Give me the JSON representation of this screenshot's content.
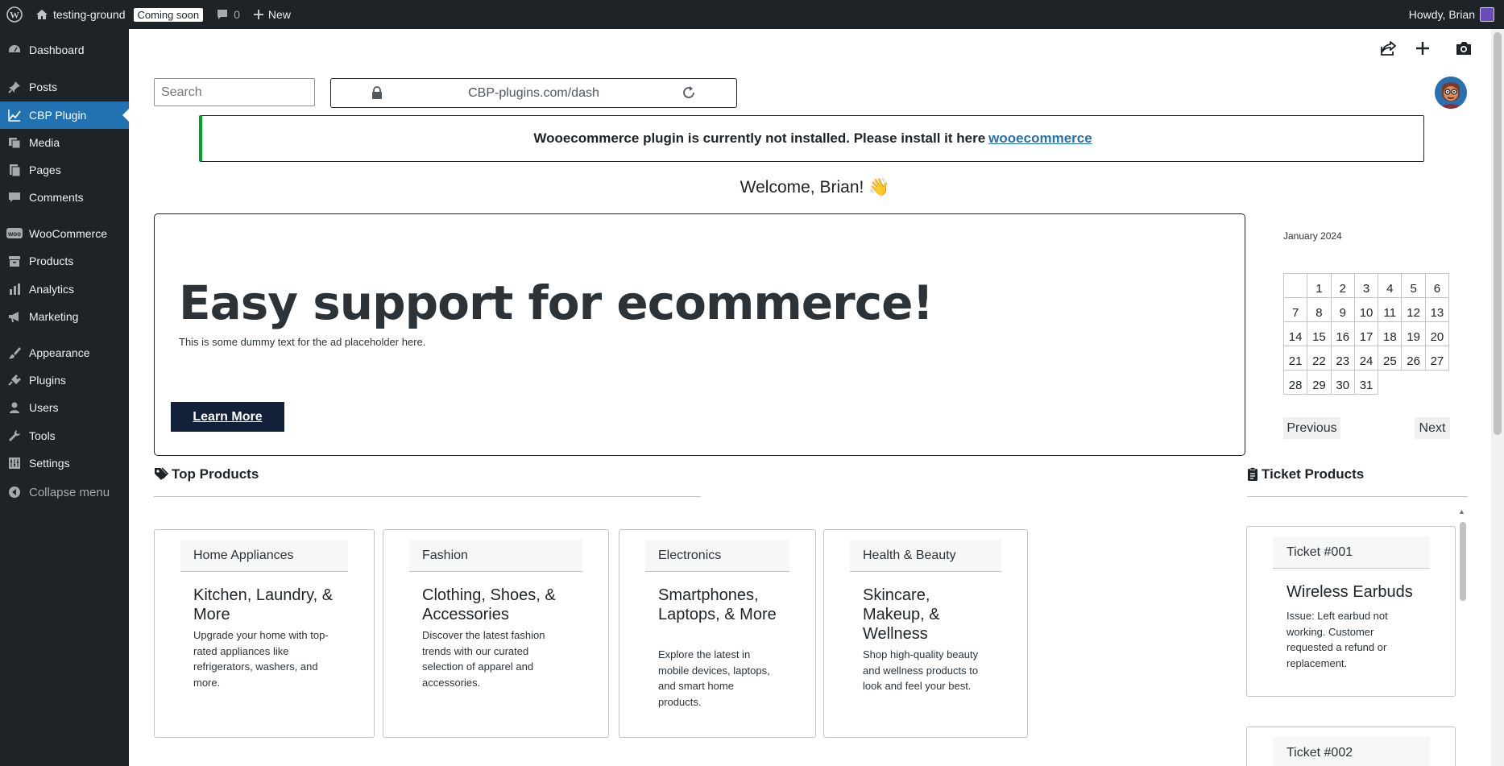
{
  "adminbar": {
    "site_name": "testing-ground",
    "badge": "Coming soon",
    "comments_count": "0",
    "new_label": "New",
    "howdy": "Howdy, Brian"
  },
  "sidebar": {
    "items": [
      {
        "label": "Dashboard",
        "icon": "dashboard-icon"
      },
      {
        "label": "Posts",
        "icon": "pin-icon"
      },
      {
        "label": "CBP Plugin",
        "icon": "chart-line-icon",
        "active": true
      },
      {
        "label": "Media",
        "icon": "media-icon"
      },
      {
        "label": "Pages",
        "icon": "pages-icon"
      },
      {
        "label": "Comments",
        "icon": "comment-icon"
      },
      {
        "label": "WooCommerce",
        "icon": "woo-icon"
      },
      {
        "label": "Products",
        "icon": "archive-icon"
      },
      {
        "label": "Analytics",
        "icon": "bar-chart-icon"
      },
      {
        "label": "Marketing",
        "icon": "megaphone-icon"
      },
      {
        "label": "Appearance",
        "icon": "brush-icon"
      },
      {
        "label": "Plugins",
        "icon": "plug-icon"
      },
      {
        "label": "Users",
        "icon": "user-icon"
      },
      {
        "label": "Tools",
        "icon": "wrench-icon"
      },
      {
        "label": "Settings",
        "icon": "sliders-icon"
      },
      {
        "label": "Collapse menu",
        "icon": "collapse-icon"
      }
    ]
  },
  "search": {
    "placeholder": "Search"
  },
  "urlbar": {
    "url": "CBP-plugins.com/dash"
  },
  "notice": {
    "text": "Wooecommerce plugin is currently not installed. Please install it here",
    "link": "wooecommerce"
  },
  "welcome": "Welcome, Brian! 👋",
  "hero": {
    "title": "Easy support for ecommerce!",
    "text": "This is some dummy text for the ad placeholder here.",
    "button": "Learn More"
  },
  "calendar": {
    "caption": "January 2024",
    "weeks": [
      [
        "",
        "1",
        "2",
        "3",
        "4",
        "5",
        "6"
      ],
      [
        "7",
        "8",
        "9",
        "10",
        "11",
        "12",
        "13"
      ],
      [
        "14",
        "15",
        "16",
        "17",
        "18",
        "19",
        "20"
      ],
      [
        "21",
        "22",
        "23",
        "24",
        "25",
        "26",
        "27"
      ],
      [
        "28",
        "29",
        "30",
        "31",
        "",
        "",
        ""
      ]
    ],
    "prev": "Previous",
    "next": "Next"
  },
  "top_products": {
    "heading": "Top Products",
    "cards": [
      {
        "category": "Home Appliances",
        "title": "Kitchen, Laundry, & More",
        "desc": "Upgrade your home with top-rated appliances like refrigerators, washers, and more."
      },
      {
        "category": "Fashion",
        "title": "Clothing, Shoes, & Accessories",
        "desc": "Discover the latest fashion trends with our curated selection of apparel and accessories."
      },
      {
        "category": "Electronics",
        "title": "Smartphones, Laptops, & More",
        "desc": "Explore the latest in mobile devices, laptops, and smart home products."
      },
      {
        "category": "Health & Beauty",
        "title": "Skincare, Makeup, & Wellness",
        "desc": "Shop high-quality beauty and wellness products to look and feel your best."
      }
    ]
  },
  "ticket_products": {
    "heading": "Ticket Products",
    "tickets": [
      {
        "number": "Ticket #001",
        "title": "Wireless Earbuds",
        "desc": "Issue: Left earbud not working. Customer requested a refund or replacement."
      },
      {
        "number": "Ticket #002",
        "title": "",
        "desc": ""
      }
    ]
  },
  "colors": {
    "admin_bg": "#1d2327",
    "accent": "#2271b1",
    "notice_border": "#00a32a",
    "button_bg": "#13203a"
  }
}
